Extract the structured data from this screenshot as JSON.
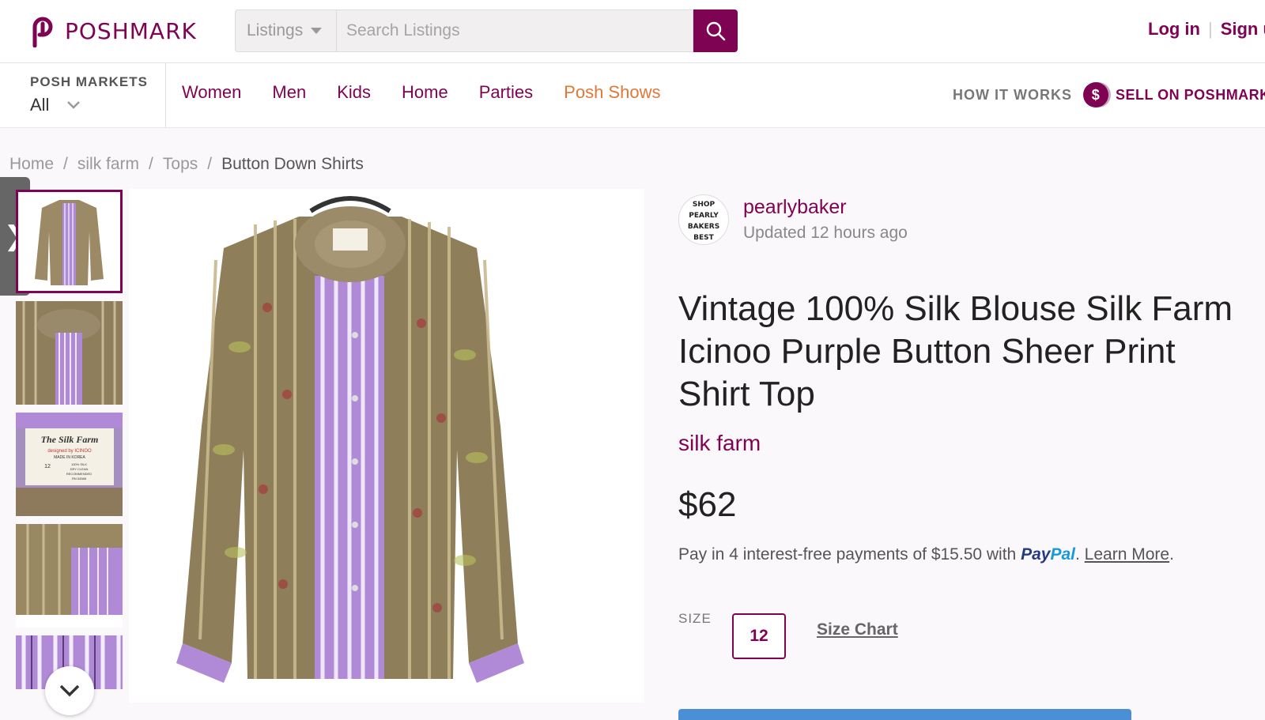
{
  "header": {
    "brand": "POSHMARK",
    "search": {
      "category": "Listings",
      "placeholder": "Search Listings"
    },
    "login": "Log in",
    "signup": "Sign up"
  },
  "nav": {
    "markets_label": "POSH MARKETS",
    "markets_value": "All",
    "links": [
      "Women",
      "Men",
      "Kids",
      "Home",
      "Parties",
      "Posh Shows"
    ],
    "how_it_works": "HOW IT WORKS",
    "sell_icon": "$",
    "sell": "SELL ON POSHMARK"
  },
  "breadcrumb": [
    "Home",
    "silk farm",
    "Tops",
    "Button Down Shirts"
  ],
  "breadcrumb_sep": "/",
  "sidetab_icon": "❯",
  "listing": {
    "seller": {
      "avatar_text": [
        "SHOP",
        "PEARLY",
        "BAKERS",
        "BEST"
      ],
      "name": "pearlybaker",
      "updated": "Updated 12 hours ago"
    },
    "title": "Vintage 100% Silk Blouse Silk Farm Icinoo Purple Button Sheer Print Shirt Top",
    "brand": "silk farm",
    "price": "$62",
    "paypal": {
      "prefix": "Pay in 4 interest-free payments of $15.50 with",
      "pay": "Pay",
      "pal": "Pal",
      "dot": ".",
      "learn_more": "Learn More",
      "end": "."
    },
    "size_label": "SIZE",
    "size": "12",
    "size_chart": "Size Chart",
    "label_tag": {
      "line1": "The Silk Farm",
      "line2": "designed by ICINOO",
      "line3": "MADE IN KOREA",
      "size": "12",
      "care": [
        "100% SILK",
        "DRY CLEAN",
        "RECOMMENDED",
        "RN 54588"
      ]
    }
  },
  "colors": {
    "brand": "#7f0353",
    "accent_orange": "#e07838",
    "lavender": "#b08ad6",
    "paypal_dark": "#253b80",
    "paypal_light": "#179bd7"
  }
}
